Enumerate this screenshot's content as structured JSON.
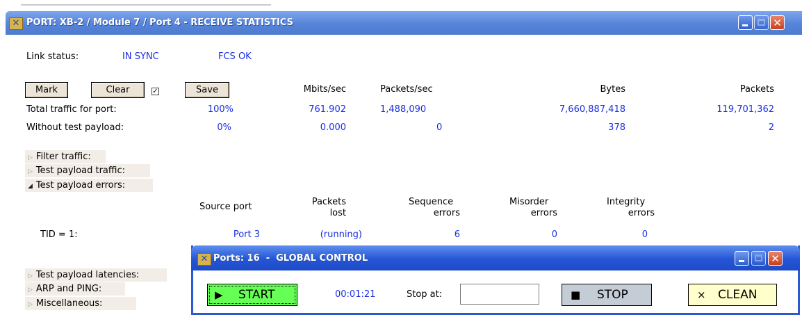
{
  "window": {
    "title": "PORT: XB-2 / Module 7 / Port 4 - RECEIVE STATISTICS",
    "icon": "app-x-icon"
  },
  "link": {
    "label": "Link status:",
    "sync": "IN SYNC",
    "fcs": "FCS OK"
  },
  "toolbar": {
    "mark": "Mark",
    "clear": "Clear",
    "clear_checked": "✓",
    "save": "Save"
  },
  "stats": {
    "columns": [
      "Mbits/sec",
      "Packets/sec",
      "Bytes",
      "Packets"
    ],
    "rows": [
      {
        "label": "Total traffic for port:",
        "percent": "100%",
        "mbits": "761.902",
        "pps": "1,488,090",
        "bytes": "7,660,887,418",
        "packets": "119,701,362"
      },
      {
        "label": "Without test payload:",
        "percent": "0%",
        "mbits": "0.000",
        "pps": "0",
        "bytes": "378",
        "packets": "2"
      }
    ]
  },
  "sections": {
    "filter": "Filter traffic:",
    "payload_traffic": "Test payload traffic:",
    "payload_errors": "Test payload errors:",
    "latencies": "Test payload latencies:",
    "arp": "ARP and PING:",
    "misc": "Miscellaneous:"
  },
  "errors": {
    "headers": {
      "source_port": "Source port",
      "packets_lost_1": "Packets",
      "packets_lost_2": "lost",
      "sequence_1": "Sequence",
      "sequence_2": "errors",
      "misorder_1": "Misorder",
      "misorder_2": "errors",
      "integrity_1": "Integrity",
      "integrity_2": "errors"
    },
    "row": {
      "tid": "TID = 1:",
      "source": "Port 3",
      "lost": "(running)",
      "sequence": "6",
      "misorder": "0",
      "integrity": "0"
    }
  },
  "global_control": {
    "title": "Ports: 16  -  GLOBAL CONTROL",
    "start": "START",
    "elapsed": "00:01:21",
    "stop_at_label": "Stop at:",
    "stop_at_value": "",
    "stop": "STOP",
    "clean": "CLEAN"
  },
  "colors": {
    "value_blue": "#1a2fe0",
    "title_blue": "#4f7bd0",
    "start_green": "#66ff55",
    "clean_yellow": "#ffffcc"
  }
}
